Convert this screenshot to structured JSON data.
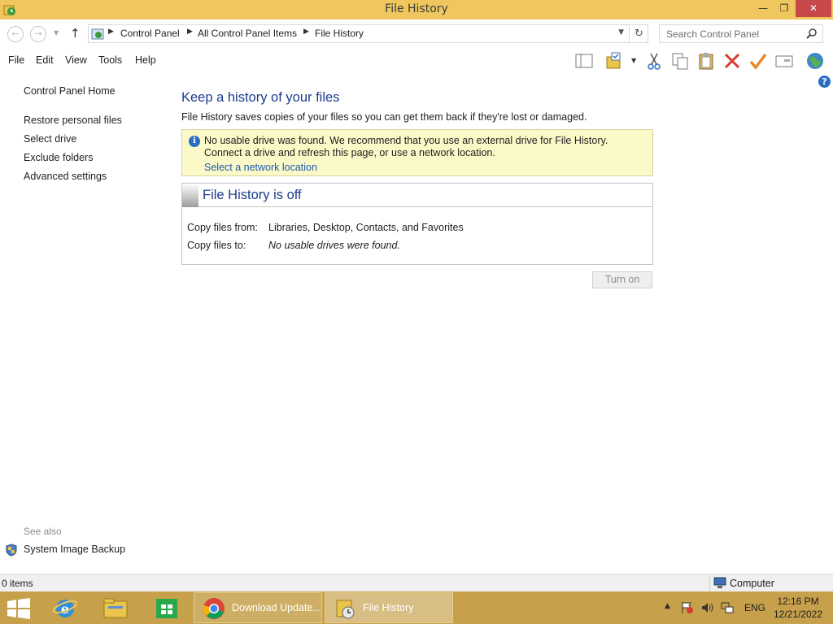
{
  "window": {
    "title": "File History",
    "minimize": "—",
    "maximize": "❐",
    "close": "✕"
  },
  "address": {
    "breadcrumbs": [
      "Control Panel",
      "All Control Panel Items",
      "File History"
    ],
    "search_placeholder": "Search Control Panel"
  },
  "menu": [
    "File",
    "Edit",
    "View",
    "Tools",
    "Help"
  ],
  "toolbar_icons": [
    "layout-icon",
    "folder-options-icon",
    "cut-icon",
    "copy-icon",
    "paste-icon",
    "delete-icon",
    "checkmark-icon",
    "properties-icon",
    "globe-icon"
  ],
  "sidebar": {
    "home": "Control Panel Home",
    "items": [
      "Restore personal files",
      "Select drive",
      "Exclude folders",
      "Advanced settings"
    ],
    "see_also_label": "See also",
    "see_also_items": [
      "System Image Backup"
    ]
  },
  "main": {
    "title": "Keep a history of your files",
    "description": "File History saves copies of your files so you can get them back if they're lost or damaged.",
    "info": {
      "text": "No usable drive was found. We recommend that you use an external drive for File History. Connect a drive and refresh this page, or use a network location.",
      "link": "Select a network location"
    },
    "status": {
      "title": "File History is off",
      "copy_from_label": "Copy files from:",
      "copy_from_value": "Libraries, Desktop, Contacts, and Favorites",
      "copy_to_label": "Copy files to:",
      "copy_to_value": "No usable drives were found."
    },
    "turn_on": "Turn on"
  },
  "statusbar": {
    "items": "0 items",
    "location": "Computer"
  },
  "taskbar": {
    "tasks": [
      "Download Update...",
      "File History"
    ],
    "lang": "ENG",
    "time": "12:16 PM",
    "date": "12/21/2022"
  },
  "colors": {
    "titlebar": "#f0c75e",
    "taskbar": "#c6a04a",
    "heading": "#1c3d8c",
    "link": "#1a5bb5",
    "info_bg": "#fbf9c8"
  }
}
